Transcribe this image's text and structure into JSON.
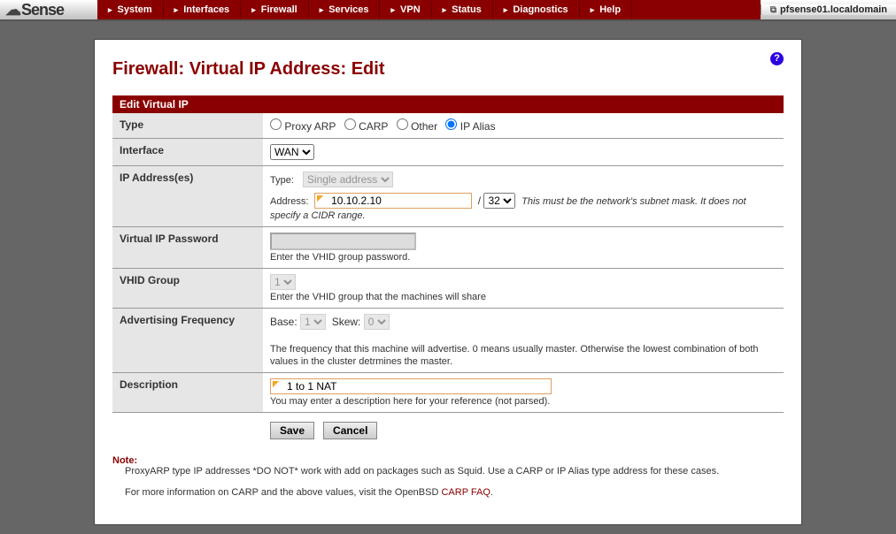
{
  "brand": "Sense",
  "menu": [
    "System",
    "Interfaces",
    "Firewall",
    "Services",
    "VPN",
    "Status",
    "Diagnostics",
    "Help"
  ],
  "hostname": "pfsense01.localdomain",
  "page": {
    "title": "Firewall: Virtual IP Address: Edit",
    "section": "Edit Virtual IP"
  },
  "fields": {
    "type": {
      "label": "Type",
      "options": [
        "Proxy ARP",
        "CARP",
        "Other",
        "IP Alias"
      ],
      "selected": "IP Alias"
    },
    "interface": {
      "label": "Interface",
      "value": "WAN"
    },
    "ip": {
      "label": "IP Address(es)",
      "type_label": "Type:",
      "type_value": "Single address",
      "addr_label": "Address:",
      "addr_value": "10.10.2.10",
      "cidr": "32",
      "hint": "This must be the network's subnet mask. It does not specify a CIDR range."
    },
    "vip_pw": {
      "label": "Virtual IP Password",
      "value": "",
      "hint": "Enter the VHID group password."
    },
    "vhid": {
      "label": "VHID Group",
      "value": "1",
      "hint": "Enter the VHID group that the machines will share"
    },
    "adv": {
      "label": "Advertising Frequency",
      "base_label": "Base:",
      "base_value": "1",
      "skew_label": "Skew:",
      "skew_value": "0",
      "hint": "The frequency that this machine will advertise. 0 means usually master. Otherwise the lowest combination of both values in the cluster detrmines the master."
    },
    "desc": {
      "label": "Description",
      "value": "1 to 1 NAT",
      "hint": "You may enter a description here for your reference (not parsed)."
    }
  },
  "buttons": {
    "save": "Save",
    "cancel": "Cancel"
  },
  "note": {
    "label": "Note:",
    "line1": "ProxyARP type IP addresses *DO NOT* work with add on packages such as Squid. Use a CARP or IP Alias type address for these cases.",
    "line2a": "For more information on CARP and the above values, visit the OpenBSD ",
    "link": "CARP FAQ",
    "line2b": "."
  }
}
